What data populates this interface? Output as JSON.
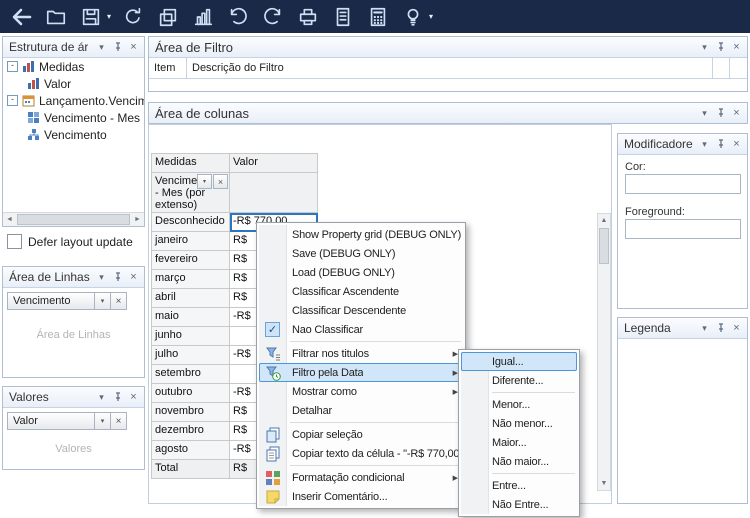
{
  "toolbar": {
    "buttons": [
      "back",
      "open-folder",
      "save",
      "refresh",
      "copy",
      "chart",
      "undo",
      "redo",
      "print",
      "print-preview",
      "calculator",
      "tips"
    ]
  },
  "icons": {
    "dropdown": "▾",
    "close": "×",
    "submenu_arrow": "▶",
    "check": "✓",
    "left": "◄",
    "right": "►",
    "up": "▲",
    "down": "▼",
    "collapse": "-"
  },
  "estrutura": {
    "title": "Estrutura de ár",
    "tree": [
      {
        "label": "Medidas"
      },
      {
        "label": "Valor"
      },
      {
        "label": "Lançamento.Vencimen"
      },
      {
        "label": "Vencimento - Mes"
      },
      {
        "label": "Vencimento"
      }
    ]
  },
  "defer": {
    "label": "Defer layout update",
    "checked": false
  },
  "linhas": {
    "title": "Área de Linhas",
    "chip": "Vencimento",
    "placeholder": "Área de Linhas"
  },
  "valores": {
    "title": "Valores",
    "chip": "Valor",
    "placeholder": "Valores"
  },
  "filtro": {
    "title": "Área de Filtro",
    "col1": "Item",
    "col2": "Descrição do Filtro"
  },
  "colunas": {
    "title": "Área de colunas"
  },
  "modificadores": {
    "title": "Modificadore",
    "cor_label": "Cor:",
    "foreground_label": "Foreground:",
    "cor_value": "",
    "foreground_value": ""
  },
  "legenda": {
    "title": "Legenda"
  },
  "pivot": {
    "measures_header": "Medidas",
    "value_header": "Valor",
    "field_line1": "Vencimento",
    "field_line2": "- Mes (por extenso)",
    "rows": [
      {
        "label": "Desconhecido",
        "value": "-R$ 770,00",
        "selected": true
      },
      {
        "label": "janeiro",
        "value": "R$"
      },
      {
        "label": "fevereiro",
        "value": "R$"
      },
      {
        "label": "março",
        "value": "R$"
      },
      {
        "label": "abril",
        "value": "R$"
      },
      {
        "label": "maio",
        "value": "-R$"
      },
      {
        "label": "junho",
        "value": ""
      },
      {
        "label": "julho",
        "value": "-R$"
      },
      {
        "label": "setembro",
        "value": ""
      },
      {
        "label": "outubro",
        "value": "-R$"
      },
      {
        "label": "novembro",
        "value": "R$"
      },
      {
        "label": "dezembro",
        "value": "R$"
      },
      {
        "label": "agosto",
        "value": "-R$"
      },
      {
        "label": "Total",
        "value": "R$"
      }
    ]
  },
  "context_menu": {
    "items": [
      {
        "label": "Show Property grid (DEBUG ONLY)"
      },
      {
        "label": "Save (DEBUG ONLY)"
      },
      {
        "label": "Load (DEBUG ONLY)"
      },
      {
        "label": "Classificar Ascendente"
      },
      {
        "label": "Classificar Descendente"
      },
      {
        "label": "Nao Classificar",
        "checked": true
      },
      {
        "label": "Filtrar nos titulos",
        "icon": "filter-text-icon",
        "submenu": true
      },
      {
        "label": "Filtro pela Data",
        "icon": "filter-date-icon",
        "submenu": true,
        "highlighted": true
      },
      {
        "label": "Mostrar como",
        "submenu": true
      },
      {
        "label": "Detalhar"
      },
      {
        "label": "Copiar seleção",
        "icon": "copy-selection-icon"
      },
      {
        "label": "Copiar texto da célula - \"-R$ 770,00\"",
        "icon": "copy-text-icon"
      },
      {
        "label": "Formatação condicional",
        "icon": "conditional-formatting-icon",
        "submenu": true
      },
      {
        "label": "Inserir Comentário...",
        "icon": "comment-icon"
      }
    ]
  },
  "date_submenu": {
    "items": [
      {
        "label": "Igual...",
        "highlighted": true
      },
      {
        "label": "Diferente..."
      },
      {
        "label": "Menor..."
      },
      {
        "label": "Não menor..."
      },
      {
        "label": "Maior..."
      },
      {
        "label": "Não maior..."
      },
      {
        "label": "Entre..."
      },
      {
        "label": "Não Entre..."
      }
    ]
  }
}
